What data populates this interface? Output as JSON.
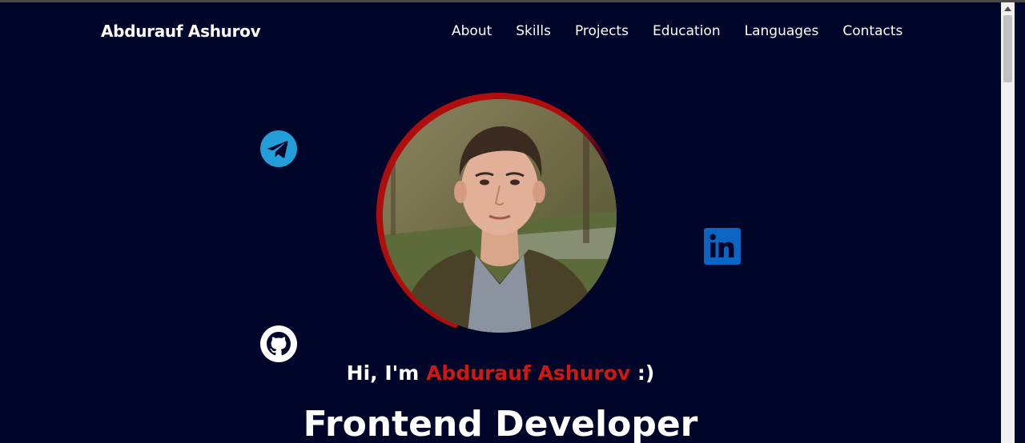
{
  "header": {
    "brand": "Abdurauf Ashurov",
    "nav": [
      "About",
      "Skills",
      "Projects",
      "Education",
      "Languages",
      "Contacts"
    ]
  },
  "hero": {
    "greeting_prefix": "Hi, I'm ",
    "greeting_name": "Abdurauf Ashurov",
    "greeting_suffix": " :)",
    "role": "Frontend Developer"
  },
  "social": {
    "telegram_icon": "telegram-icon",
    "linkedin_icon": "linkedin-icon",
    "github_icon": "github-icon"
  },
  "colors": {
    "background": "#00052a",
    "accent": "#cc1a12",
    "telegram": "#229ed9",
    "linkedin": "#0a66c2"
  }
}
